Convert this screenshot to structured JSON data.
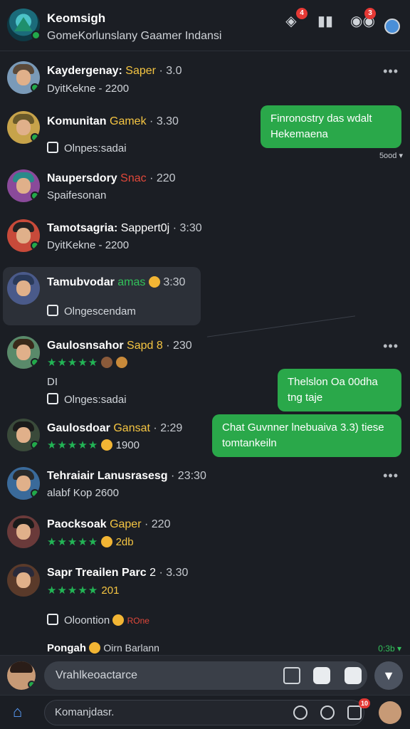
{
  "header": {
    "title": "Keomsigh",
    "subtitle": "GomeKorlunslany Gaamer Indansi",
    "icons": [
      "tag-icon",
      "signal-icon",
      "people-icon",
      "globe-icon"
    ],
    "badge_1": "4",
    "badge_2": "3"
  },
  "rows": [
    {
      "name": "Kaydergenay:",
      "tag": "Saper",
      "time": "3.0",
      "sub": "DyitKekne - 2200",
      "tag_color": "#f5c542"
    },
    {
      "name": "Komunitan",
      "tag": "Gamek",
      "time": "3.30",
      "sub": "Olnpes:sadai",
      "tag_color": "#f5c542"
    },
    {
      "name": "Naupersdory",
      "tag": "Snac",
      "time": "220",
      "sub": "Spaifesonan",
      "tag_color": "#e0483a"
    },
    {
      "name": "Tamotsagria:",
      "tag": "Sappert0j",
      "time": "3:30",
      "sub": "DyitKekne - 2200",
      "tag_color": "#ffffff"
    },
    {
      "name": "Tamubvodar",
      "tag": "amas",
      "time": "3:30",
      "sub": "Olngescendam",
      "tag_color": "#32c15a"
    },
    {
      "name": "Gaulosnsahor",
      "tag": "Sapd 8",
      "time": "230",
      "sub": "DI",
      "sub2": "Olnges:sadai",
      "tag_color": "#f5c542"
    },
    {
      "name": "Gaulosdoar",
      "tag": "Gansat",
      "time": "2:29",
      "sub": "1900",
      "tag_color": "#f5c542"
    },
    {
      "name": "Tehraiair Lanusrasesg",
      "tag": "",
      "time": "23:30",
      "sub": "alabf Kop 2600",
      "tag_color": "#ffffff"
    },
    {
      "name": "Paocksoak",
      "tag": "Gaper",
      "time": "220",
      "sub": "2db",
      "tag_color": "#f5c542"
    },
    {
      "name": "Sapr Treailen Parc",
      "tag": "2",
      "time": "3.30",
      "sub": "201",
      "sub2": "Oloontion",
      "sub2_extra": "ROne",
      "tag_color": "#ffffff"
    },
    {
      "name": "Pongah",
      "tag": "",
      "time": "",
      "sub": "Oirn Barlann",
      "tag_color": "#ffffff"
    }
  ],
  "stars": "★★★★★",
  "bubbles": [
    {
      "text": "Finronostry das wdalt Hekemaena",
      "time": "5ood ▾"
    },
    {
      "text": "Thelslon Oa 00dha tng taje"
    },
    {
      "text": "Chat Guvnner lnebuaiva 3.3) tiese tomtankeiln"
    }
  ],
  "pongah_time": "0:3b ▾",
  "composer": {
    "placeholder": "Vrahlkeoactarce"
  },
  "bottom": {
    "placeholder": "Komanjdasr.",
    "badge": "10"
  },
  "colors": {
    "accent": "#2aa84a",
    "background": "#1b1e24",
    "link": "#5aa0ff"
  }
}
